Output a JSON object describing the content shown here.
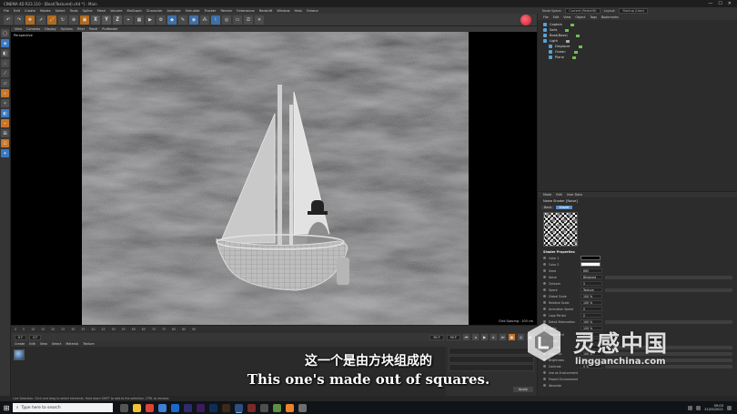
{
  "window": {
    "title": "CINEMA 4D R23.110 - [Boat(Textured).c4d *] - Main",
    "controls": [
      "—",
      "☐",
      "✕"
    ]
  },
  "menubar": [
    "File",
    "Edit",
    "Create",
    "Modes",
    "Select",
    "Tools",
    "Spline",
    "Mesh",
    "Volume",
    "MoGraph",
    "Character",
    "Animate",
    "Simulate",
    "Tracker",
    "Render",
    "Extensions",
    "Redshift",
    "Window",
    "Help",
    "Octane"
  ],
  "layout_bar": {
    "node_space_label": "Node Space:",
    "node_space_value": "Current (Redshift)",
    "layout_label": "Layout:",
    "layout_value": "Startup (User)"
  },
  "toolbar": {
    "axis_buttons": [
      "X",
      "Y",
      "Z"
    ]
  },
  "viewport": {
    "menu": [
      "View",
      "Cameras",
      "Display",
      "Options",
      "Filter",
      "Panel",
      "ProRender"
    ],
    "label": "Perspective",
    "status": "Grid Spacing : 100 cm"
  },
  "timeline": {
    "ticks": [
      "0",
      "5",
      "10",
      "15",
      "20",
      "25",
      "30",
      "35",
      "40",
      "45",
      "50",
      "55",
      "60",
      "65",
      "70",
      "75",
      "80",
      "85",
      "90"
    ],
    "frame_start": "0 F",
    "frame_end": "90 F",
    "current": "0 F",
    "end_field": "90 F"
  },
  "material_menu": [
    "Create",
    "Edit",
    "View",
    "Select",
    "Material",
    "Texture"
  ],
  "coords": {
    "apply": "Apply"
  },
  "object_menu": [
    "File",
    "Edit",
    "View",
    "Object",
    "Tags",
    "Bookmarks"
  ],
  "objects": [
    {
      "name": "Captain",
      "indent": 0
    },
    {
      "name": "Sails",
      "indent": 0
    },
    {
      "name": "Boat(Base)",
      "indent": 0
    },
    {
      "name": "Light",
      "indent": 0
    },
    {
      "name": "Displacer",
      "indent": 1
    },
    {
      "name": "Ocean",
      "indent": 1
    },
    {
      "name": "Plane",
      "indent": 1
    }
  ],
  "attribute_menu": [
    "Mode",
    "Edit",
    "User Data"
  ],
  "attribute": {
    "title": "Noise Shader [Noise]",
    "tabs": [
      "Basic",
      "Shader"
    ],
    "section": "Shader Properties",
    "rows": [
      {
        "label": "Color 1",
        "value": ""
      },
      {
        "label": "Color 2",
        "value": ""
      },
      {
        "label": "Seed",
        "value": "665"
      },
      {
        "label": "Noise",
        "value": "Blistered"
      },
      {
        "label": "Octaves",
        "value": "5"
      },
      {
        "label": "Space",
        "value": "Texture"
      },
      {
        "label": "Global Scale",
        "value": "100 %"
      },
      {
        "label": "Relative Scale",
        "value": "100 %"
      },
      {
        "label": "Animation Speed",
        "value": "0"
      },
      {
        "label": "Loop Period",
        "value": "0"
      },
      {
        "label": "Detail Attenuation",
        "value": "100 %"
      },
      {
        "label": "Delta",
        "value": "100 %"
      },
      {
        "label": "Movement",
        "value": "0 cm"
      },
      {
        "label": "Speed",
        "value": "0"
      },
      {
        "label": "Low Clip",
        "value": "0 %"
      },
      {
        "label": "High Clip",
        "value": "100 %"
      },
      {
        "label": "Brightness",
        "value": "0 %"
      },
      {
        "label": "Contrast",
        "value": "0 %"
      },
      {
        "label": "Use as Environment",
        "value": ""
      },
      {
        "label": "Project Environment",
        "value": ""
      },
      {
        "label": "Absolute",
        "value": ""
      }
    ]
  },
  "subtitle": {
    "cn": "这一个是由方块组成的",
    "en": "This one's made out of squares."
  },
  "watermark": {
    "cn": "灵感中国",
    "url": "lingganchina.com"
  },
  "statusbar": "Live Selection: Click and drag to select elements. Hold down SHIFT to add to the selection, CTRL to remove.",
  "taskbar": {
    "search_placeholder": "Type here to search",
    "time": "09:03",
    "date": "21/05/2021"
  },
  "colors": {
    "accent_orange": "#c9742a",
    "accent_blue": "#3b78c2",
    "render_red": "#c81c2c"
  }
}
